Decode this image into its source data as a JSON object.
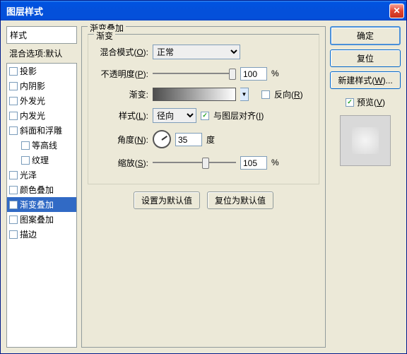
{
  "title": "图层样式",
  "left": {
    "header": "样式",
    "sub": "混合选项:默认",
    "items": [
      {
        "label": "投影",
        "ck": false
      },
      {
        "label": "内阴影",
        "ck": false
      },
      {
        "label": "外发光",
        "ck": false
      },
      {
        "label": "内发光",
        "ck": false
      },
      {
        "label": "斜面和浮雕",
        "ck": false
      },
      {
        "label": "等高线",
        "ck": false,
        "indent": true
      },
      {
        "label": "纹理",
        "ck": false,
        "indent": true
      },
      {
        "label": "光泽",
        "ck": false
      },
      {
        "label": "颜色叠加",
        "ck": false
      },
      {
        "label": "渐变叠加",
        "ck": true,
        "sel": true
      },
      {
        "label": "图案叠加",
        "ck": false
      },
      {
        "label": "描边",
        "ck": false
      }
    ]
  },
  "center": {
    "group": "渐变叠加",
    "inner": "渐变",
    "blend": {
      "label": "混合模式(",
      "u": "O",
      "after": "):",
      "value": "正常"
    },
    "opacity": {
      "label": "不透明度(",
      "u": "P",
      "after": "):",
      "value": "100",
      "pct": "%",
      "pos": 100
    },
    "gradient": {
      "label": "渐变:",
      "reverse": {
        "u": "R",
        "text": "反向("
      }
    },
    "style": {
      "label": "样式(",
      "u": "L",
      "after": "):",
      "value": "径向",
      "align": {
        "u": "I",
        "text": "与图层对齐("
      },
      "alignck": true
    },
    "angle": {
      "label": "角度(",
      "u": "N",
      "after": "):",
      "value": "35",
      "unit": "度"
    },
    "scale": {
      "label": "缩放(",
      "u": "S",
      "after": "):",
      "value": "105",
      "pct": "%",
      "pos": 62
    },
    "btn1": "设置为默认值",
    "btn2": "复位为默认值"
  },
  "right": {
    "ok": "确定",
    "cancel": "复位",
    "newstyle": {
      "a": "新建样式(",
      "u": "W",
      "b": ")..."
    },
    "preview": {
      "u": "V",
      "text": "预览("
    },
    "previewck": true
  }
}
